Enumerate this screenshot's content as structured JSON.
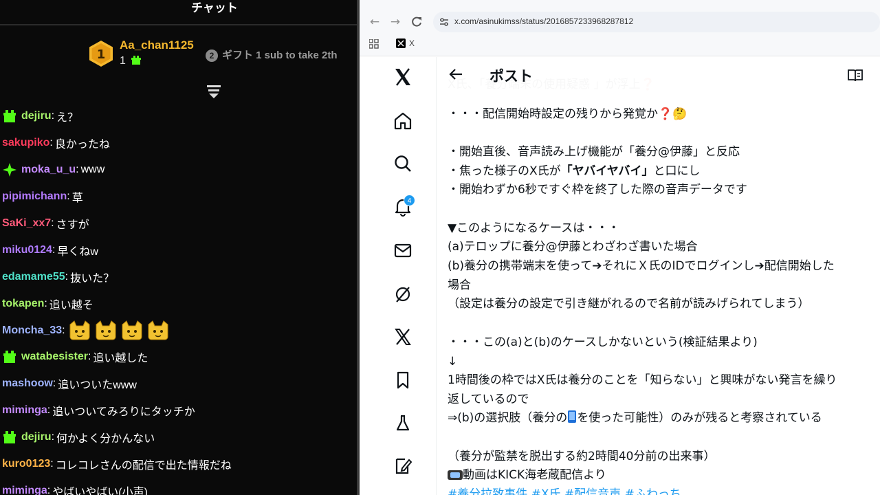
{
  "chat": {
    "title": "チャット",
    "gift_leader": {
      "rank": "1",
      "user": "Aa_chan1125",
      "count": "1"
    },
    "gift_second": {
      "rank": "2",
      "text": "ギフト 1 sub to take 2th"
    },
    "messages": [
      {
        "badge": "gift-sub-icon",
        "user": "dejiru",
        "color": "#a6f26a",
        "text": "え？"
      },
      {
        "badge": null,
        "user": "sakupiko",
        "color": "#ff3b5c",
        "text": "良かったね"
      },
      {
        "badge": "sparkle-icon",
        "user": "moka_u_u",
        "color": "#c48bff",
        "text": "www"
      },
      {
        "badge": null,
        "user": "pipimichann",
        "color": "#b57bff",
        "text": "草"
      },
      {
        "badge": null,
        "user": "SaKi_xx7",
        "color": "#ff5a7a",
        "text": "さすが"
      },
      {
        "badge": null,
        "user": "miku0124",
        "color": "#b07cff",
        "text": "早くねw"
      },
      {
        "badge": null,
        "user": "edamame55",
        "color": "#4fe0c8",
        "text": "抜いた？"
      },
      {
        "badge": null,
        "user": "tokapen",
        "color": "#a6f26a",
        "text": "追い越そ"
      },
      {
        "badge": null,
        "user": "Moncha_33",
        "color": "#9fb4ff",
        "text": "",
        "emotes": 4
      },
      {
        "badge": "gift-sub-icon",
        "user": "watabesister",
        "color": "#a6f26a",
        "text": "追い越した"
      },
      {
        "badge": null,
        "user": "mashoow",
        "color": "#9fb4ff",
        "text": "追いついたwww"
      },
      {
        "badge": null,
        "user": "miminga",
        "color": "#c48bff",
        "text": "追いついてみろりにタッチか"
      },
      {
        "badge": "gift-sub-icon",
        "user": "dejiru",
        "color": "#a6f26a",
        "text": "何かよく分かんない"
      },
      {
        "badge": null,
        "user": "kuro0123",
        "color": "#ffb347",
        "text": "コレコレさんの配信で出た情報だね"
      },
      {
        "badge": null,
        "user": "miminga",
        "color": "#c48bff",
        "text": "やばいやばい(小声)"
      }
    ]
  },
  "browser": {
    "url": "x.com/asinukimss/status/2016857233968287812",
    "tab_label": "X",
    "notification_count": "4"
  },
  "post": {
    "header_title": "ポスト",
    "lines": [
      {
        "text": "X氏、「養分端末の使用疑惑 」が浮上❓",
        "partial": true
      },
      {
        "text": "・・・配信開始時設定の残りから発覚か❓🤔"
      },
      {
        "text": ""
      },
      {
        "text": "・開始直後、音声読み上げ機能が「養分@伊藤」と反応"
      },
      {
        "text": "・焦った様子のX氏が",
        "bold": "「ヤバイヤバイ」",
        "after": "と口にし"
      },
      {
        "text": "・開始わずか6秒ですぐ枠を終了した際の音声データです"
      },
      {
        "text": ""
      },
      {
        "text": "▼このようになるケースは・・・"
      },
      {
        "text": "(a)テロップに養分@伊藤とわざわざ書いた場合"
      },
      {
        "text": "(b)養分の携帯端末を使って➔それにＸ氏のIDでログインし➔配信開始した"
      },
      {
        "text": "場合"
      },
      {
        "text": "（設定は養分の設定で引き継がれるので名前が読みげられてしまう）"
      },
      {
        "text": ""
      },
      {
        "text": "・・・この(a)と(b)のケースしかないという(検証結果より)"
      },
      {
        "text": "↓"
      },
      {
        "text": "1時間後の枠ではX氏は養分のことを「知らない」と興味がない発言を繰り"
      },
      {
        "text": "返しているので"
      },
      {
        "text": "⇒(b)の選択肢（養分の",
        "after": "を使った可能性）のみが残ると考察されている"
      },
      {
        "text": ""
      },
      {
        "text": "（養分が監禁を脱出する約2時間40分前の出来事）"
      },
      {
        "text": "動画はKICK海老蔵配信より"
      },
      {
        "text": "#養分拉致事件 #X氏 #配信音声 #ふわっち",
        "hashtag": true
      }
    ]
  },
  "colors": {
    "accent_blue": "#1d9bf0",
    "gold": "#f5b82e",
    "kick_green": "#53fc18"
  }
}
